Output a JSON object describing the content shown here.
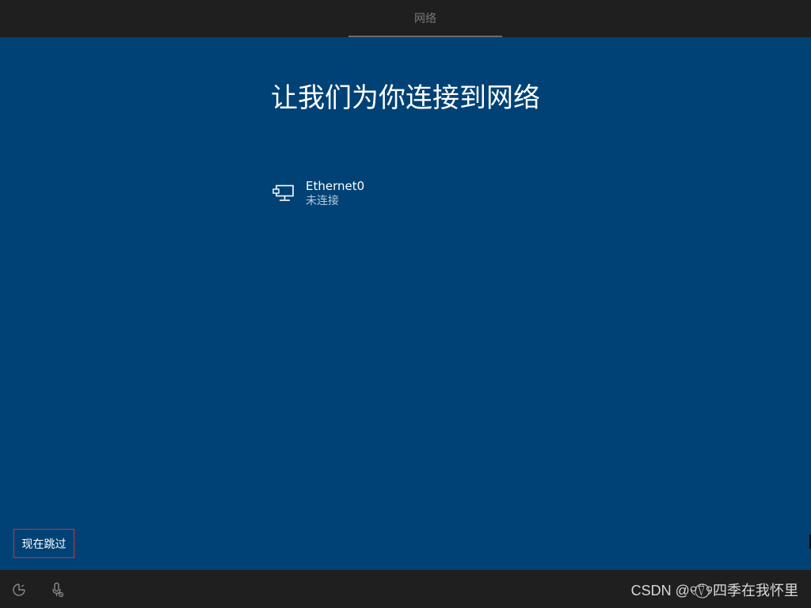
{
  "top_bar": {
    "tab_label": "网络"
  },
  "main": {
    "title": "让我们为你连接到网络",
    "networks": [
      {
        "name": "Ethernet0",
        "status": "未连接",
        "icon": "ethernet-network-icon"
      }
    ],
    "skip_label": "现在跳过"
  },
  "bottom_bar": {
    "icons": [
      "ease-of-access-icon",
      "microphone-icon"
    ],
    "watermark": "CSDN @୧⍢⃝୨四季在我怀里"
  },
  "colors": {
    "background_blue": "#004275",
    "bar_dark": "#1f1f1f",
    "highlight_border": "#c8323a",
    "text_white": "#ffffff"
  }
}
